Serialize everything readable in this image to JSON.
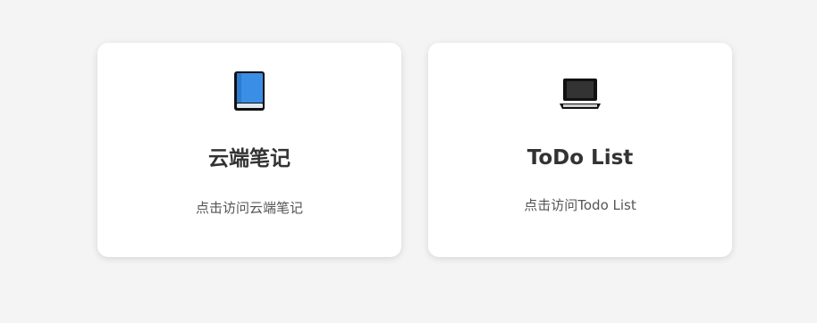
{
  "cards": [
    {
      "title": "云端笔记",
      "description": "点击访问云端笔记",
      "icon": "book-icon",
      "icon_color": "#3a8ee6"
    },
    {
      "title": "ToDo List",
      "description": "点击访问Todo List",
      "icon": "laptop-icon",
      "icon_color": "#222222"
    }
  ],
  "colors": {
    "background": "#f4f4f4",
    "card": "#ffffff",
    "title": "#333333",
    "description": "#555555"
  }
}
